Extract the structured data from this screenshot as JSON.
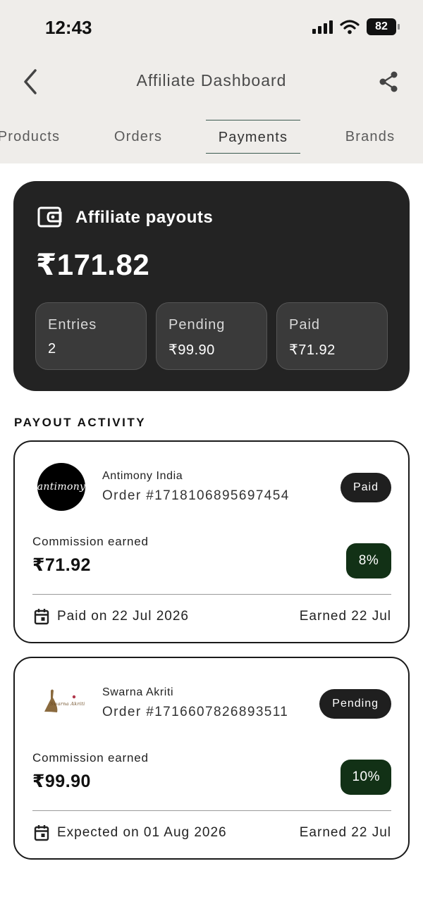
{
  "status_bar": {
    "time": "12:43",
    "battery": "82"
  },
  "header": {
    "title": "Affiliate Dashboard"
  },
  "tabs": [
    {
      "label": "Products"
    },
    {
      "label": "Orders"
    },
    {
      "label": "Payments",
      "active": true
    },
    {
      "label": "Brands"
    }
  ],
  "summary": {
    "title": "Affiliate payouts",
    "total": "₹171.82",
    "stats": [
      {
        "label": "Entries",
        "value": "2"
      },
      {
        "label": "Pending",
        "value": "₹99.90"
      },
      {
        "label": "Paid",
        "value": "₹71.92"
      }
    ]
  },
  "activity": {
    "section_title": "PAYOUT ACTIVITY",
    "items": [
      {
        "brand": "Antimony India",
        "logo_text": "antimony",
        "order": "Order #1718106895697454",
        "status": "Paid",
        "commission_label": "Commission earned",
        "commission": "₹71.92",
        "percent": "8%",
        "date_text": "Paid on 22 Jul 2026",
        "earned": "Earned 22 Jul"
      },
      {
        "brand": "Swarna Akriti",
        "logo_text": "Swarna Akriti",
        "order": "Order #1716607826893511",
        "status": "Pending",
        "commission_label": "Commission earned",
        "commission": "₹99.90",
        "percent": "10%",
        "date_text": "Expected on 01 Aug 2026",
        "earned": "Earned 22 Jul"
      }
    ]
  },
  "colors": {
    "top_bg": "#efedea",
    "card_dark": "#232323",
    "stat_bg": "#3a3a3a",
    "percent_badge": "#123116",
    "status_badge": "#1f1f1f",
    "tab_underline": "#3b5a50"
  },
  "icons": {
    "back": "chevron-left-icon",
    "share": "share-icon",
    "wallet": "wallet-icon",
    "calendar": "calendar-icon"
  }
}
